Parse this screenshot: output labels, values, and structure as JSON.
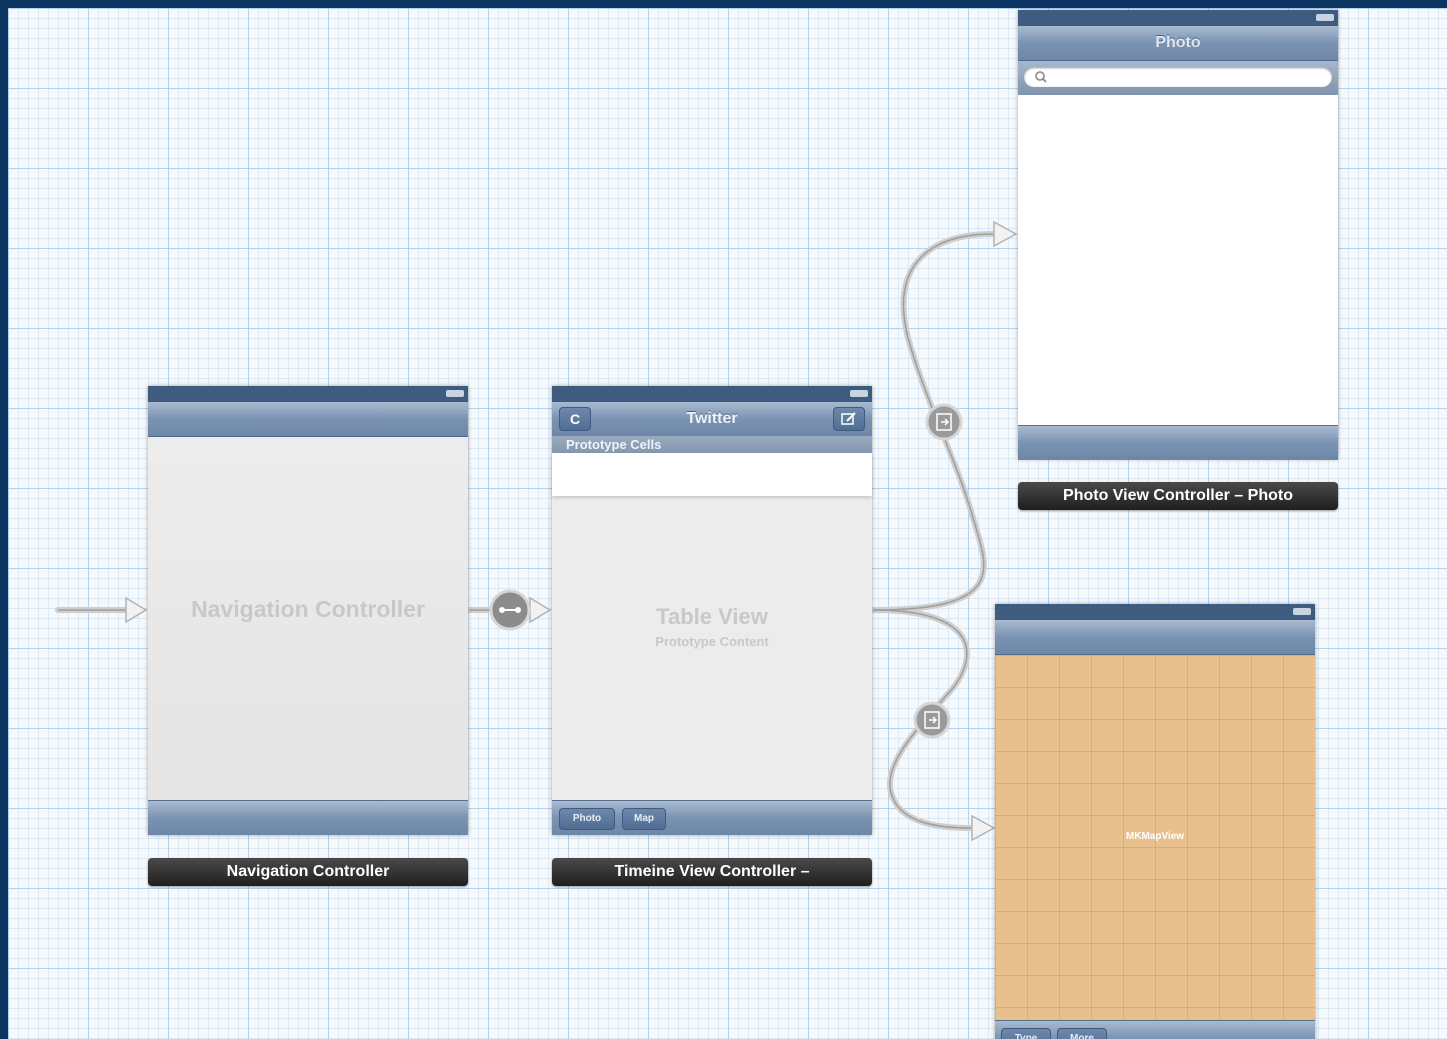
{
  "scenes": {
    "navigation_controller": {
      "placeholder": "Navigation Controller",
      "label": "Navigation Controller"
    },
    "timeline": {
      "nav_title": "Twitter",
      "refresh_icon": "C",
      "compose_icon": "compose-icon",
      "section_header": "Prototype Cells",
      "table_placeholder": "Table View",
      "table_sub": "Prototype Content",
      "toolbar": [
        "Photo",
        "Map"
      ],
      "label": "Timeine View Controller –"
    },
    "photo": {
      "nav_title": "Photo",
      "search_icon": "search-icon",
      "label": "Photo View Controller – Photo"
    },
    "map": {
      "map_label": "MKMapView",
      "map_color": "#e8c08e",
      "toolbar": [
        "Type",
        "More"
      ]
    }
  },
  "colors": {
    "grid_bg": "#f6f9fc",
    "frame": "#0b3463",
    "nav_bar": "#7b93b2",
    "label_bg": "#2a2a2a"
  }
}
